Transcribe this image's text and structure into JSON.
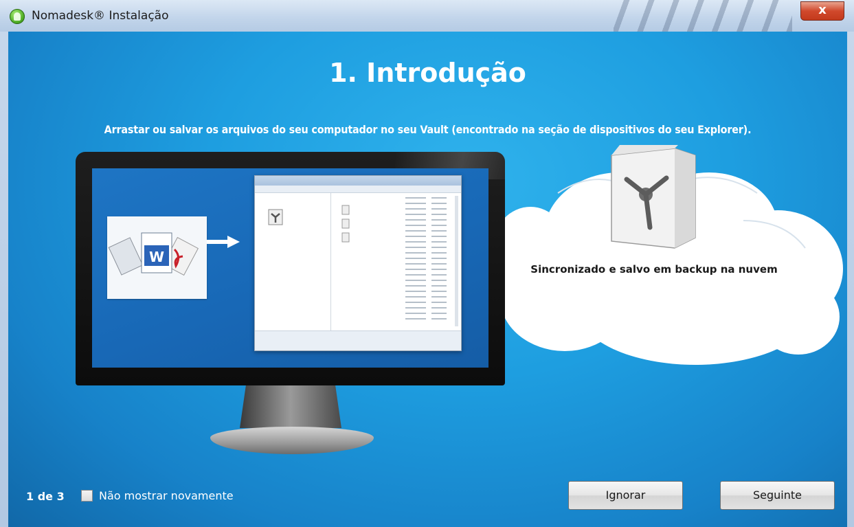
{
  "window": {
    "title": "Nomadesk® Instalação",
    "close_glyph": "x"
  },
  "main": {
    "heading": "1. Introdução",
    "subtitle": "Arrastar ou salvar os arquivos do seu computador no seu Vault (encontrado na seção de dispositivos do seu Explorer).",
    "cloud_label": "Sincronizado e salvo em backup na nuvem"
  },
  "footer": {
    "step": "1 de 3",
    "checkbox_label": "Não mostrar novamente",
    "checkbox_checked": false,
    "ignore_label": "Ignorar",
    "next_label": "Seguinte"
  },
  "icons": {
    "app": "nomadesk-logo-icon",
    "vault": "vault-safe-icon",
    "documents": "documents-icon",
    "arrow": "arrow-right-icon"
  },
  "colors": {
    "background": "#1e9ee0",
    "close": "#d1492c"
  }
}
